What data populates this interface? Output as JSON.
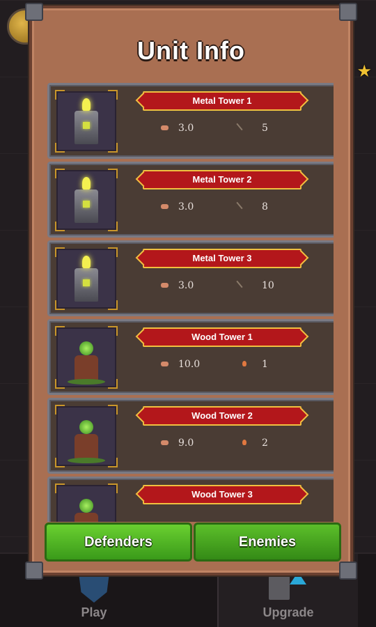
{
  "modal": {
    "title": "Unit Info",
    "units": [
      {
        "name": "Metal Tower 1",
        "stat1": "3.0",
        "stat2": "5",
        "kind": "metal",
        "stat2_icon": "pickaxe-icon"
      },
      {
        "name": "Metal Tower 2",
        "stat1": "3.0",
        "stat2": "8",
        "kind": "metal",
        "stat2_icon": "pickaxe-icon"
      },
      {
        "name": "Metal Tower 3",
        "stat1": "3.0",
        "stat2": "10",
        "kind": "metal",
        "stat2_icon": "pickaxe-icon"
      },
      {
        "name": "Wood Tower 1",
        "stat1": "10.0",
        "stat2": "1",
        "kind": "wood",
        "stat2_icon": "fire-icon"
      },
      {
        "name": "Wood Tower 2",
        "stat1": "9.0",
        "stat2": "2",
        "kind": "wood",
        "stat2_icon": "fire-icon"
      },
      {
        "name": "Wood Tower 3",
        "stat1": "",
        "stat2": "",
        "kind": "wood",
        "stat2_icon": "fire-icon"
      }
    ],
    "buttons": {
      "defenders": "Defenders",
      "enemies": "Enemies"
    }
  },
  "bottom_nav": {
    "play": "Play",
    "upgrade": "Upgrade"
  },
  "colors": {
    "panel": "#a96f52",
    "banner": "#b3171b",
    "button_green": "#4cae22"
  }
}
